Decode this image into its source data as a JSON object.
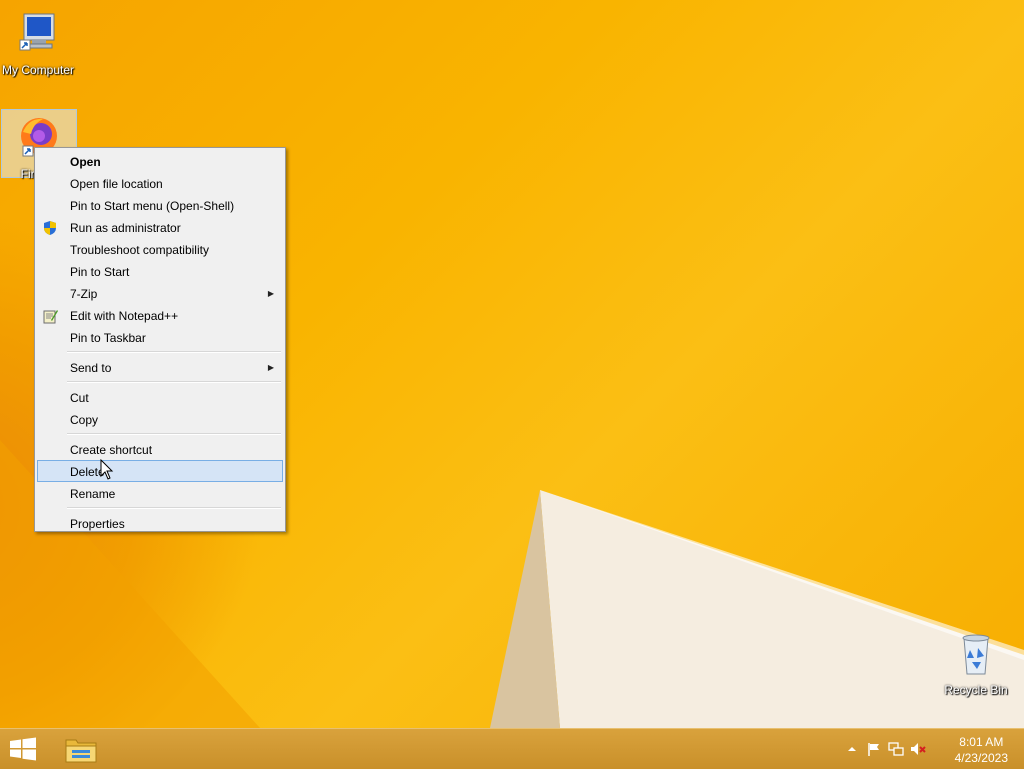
{
  "desktop": {
    "icons": [
      {
        "id": "my-computer",
        "label": "My Computer"
      },
      {
        "id": "firefox",
        "label": "Firefox"
      },
      {
        "id": "recycle-bin",
        "label": "Recycle Bin"
      }
    ]
  },
  "context_menu": {
    "items": [
      {
        "label": "Open",
        "bold": true
      },
      {
        "label": "Open file location"
      },
      {
        "label": "Pin to Start menu (Open-Shell)"
      },
      {
        "label": "Run as administrator",
        "icon": "uac-shield-icon"
      },
      {
        "label": "Troubleshoot compatibility"
      },
      {
        "label": "Pin to Start"
      },
      {
        "label": "7-Zip",
        "submenu": true
      },
      {
        "label": "Edit with Notepad++",
        "icon": "notepadpp-icon"
      },
      {
        "label": "Pin to Taskbar"
      },
      {
        "label": "Send to",
        "submenu": true
      },
      {
        "label": "Cut"
      },
      {
        "label": "Copy"
      },
      {
        "label": "Create shortcut"
      },
      {
        "label": "Delete",
        "highlighted": true
      },
      {
        "label": "Rename"
      },
      {
        "label": "Properties"
      }
    ],
    "submenu_arrow": "▶"
  },
  "taskbar": {
    "clock": {
      "time": "8:01 AM",
      "date": "4/23/2023"
    },
    "tray_icons": [
      "show-hidden-icons-chevron",
      "action-center-flag-icon",
      "network-icon",
      "volume-muted-icon"
    ]
  },
  "colors": {
    "wallpaper": "#f9b400",
    "menu_background": "#f0f0f0",
    "menu_highlight": "#d5e4f6",
    "taskbar": "#d09a30"
  }
}
